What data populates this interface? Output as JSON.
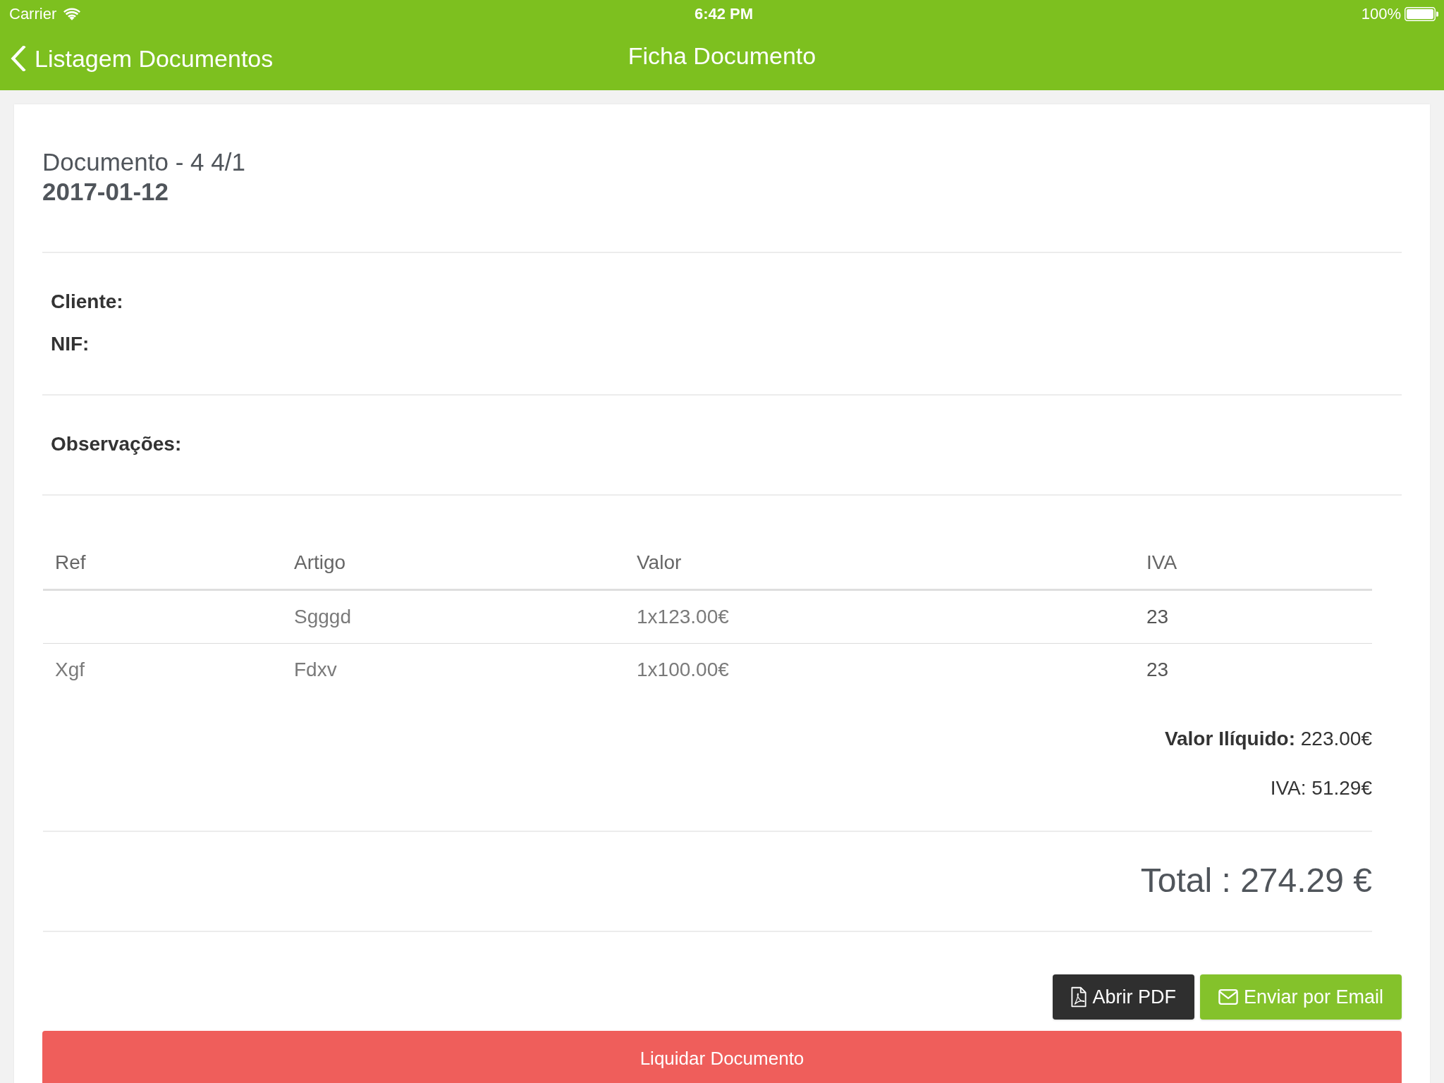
{
  "status_bar": {
    "carrier": "Carrier",
    "time": "6:42 PM",
    "battery": "100%"
  },
  "nav_bar": {
    "back": "Listagem Documentos",
    "title": "Ficha Documento"
  },
  "document": {
    "title": "Documento - 4 4/1",
    "date": "2017-01-12"
  },
  "client": {
    "fields": [
      "Cliente:",
      "NIF:"
    ]
  },
  "notes": {
    "label": "Observações:"
  },
  "table": {
    "columns": [
      "Ref",
      "Artigo",
      "Valor",
      "IVA"
    ],
    "rows": [
      {
        "artigo": "Sgggd",
        "valor": "1x123.00€",
        "iva": "23"
      },
      {
        "ref": "Xgf",
        "artigo": "Fdxv",
        "valor": "1x100.00€",
        "iva": "23"
      }
    ]
  },
  "summary": [
    "**Valor Ilíquido:** 223.00€",
    "IVA: 51.29€"
  ],
  "total": "Total : 274.29 €",
  "actions": [
    {
      "kind": "pdf",
      "label": "Abrir PDF"
    },
    {
      "kind": "email",
      "label": "Enviar por Email"
    }
  ],
  "primary_action": {
    "label": "Liquidar Documento"
  }
}
